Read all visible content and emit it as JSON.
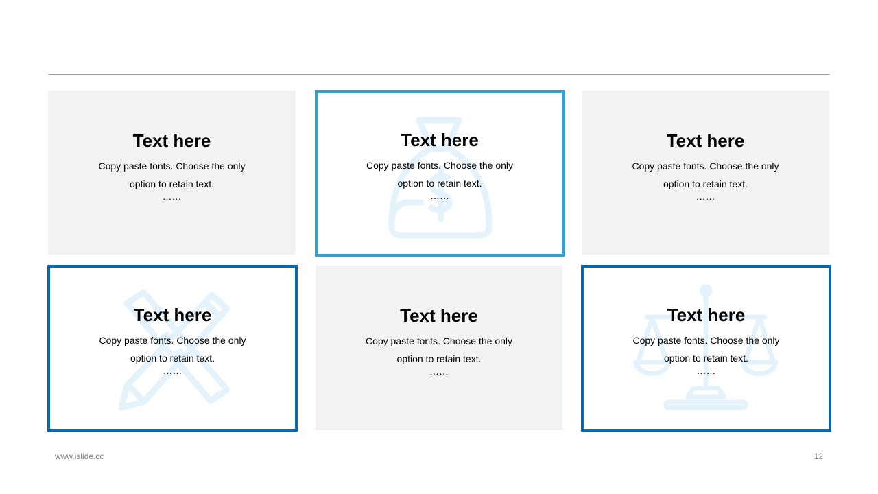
{
  "cards": [
    {
      "title": "Text here",
      "description": "Copy paste fonts. Choose the only option to retain text.",
      "dots": "……",
      "style": "filled",
      "watermark_icon": "none"
    },
    {
      "title": "Text here",
      "description": "Copy paste fonts. Choose the only option to retain text.",
      "dots": "……",
      "style": "outlined-light",
      "watermark_icon": "money-bag-icon"
    },
    {
      "title": "Text here",
      "description": "Copy paste fonts. Choose the only option to retain text.",
      "dots": "……",
      "style": "filled",
      "watermark_icon": "none"
    },
    {
      "title": "Text here",
      "description": "Copy paste fonts. Choose the only option to retain text.",
      "dots": "……",
      "style": "outlined-dark",
      "watermark_icon": "ruler-pencil-icon"
    },
    {
      "title": "Text here",
      "description": "Copy paste fonts. Choose the only option to retain text.",
      "dots": "……",
      "style": "filled",
      "watermark_icon": "none"
    },
    {
      "title": "Text here",
      "description": "Copy paste fonts. Choose the only option to retain text.",
      "dots": "……",
      "style": "outlined-dark",
      "watermark_icon": "scales-icon"
    }
  ],
  "footer": {
    "url": "www.islide.cc",
    "page_number": "12"
  },
  "colors": {
    "card_fill": "#f2f2f2",
    "border_light_blue": "#29a3dc",
    "border_dark_blue": "#0468b6",
    "watermark": "#e6f3fb",
    "rule": "#a6a6a6",
    "footer_text": "#7f7f7f"
  }
}
